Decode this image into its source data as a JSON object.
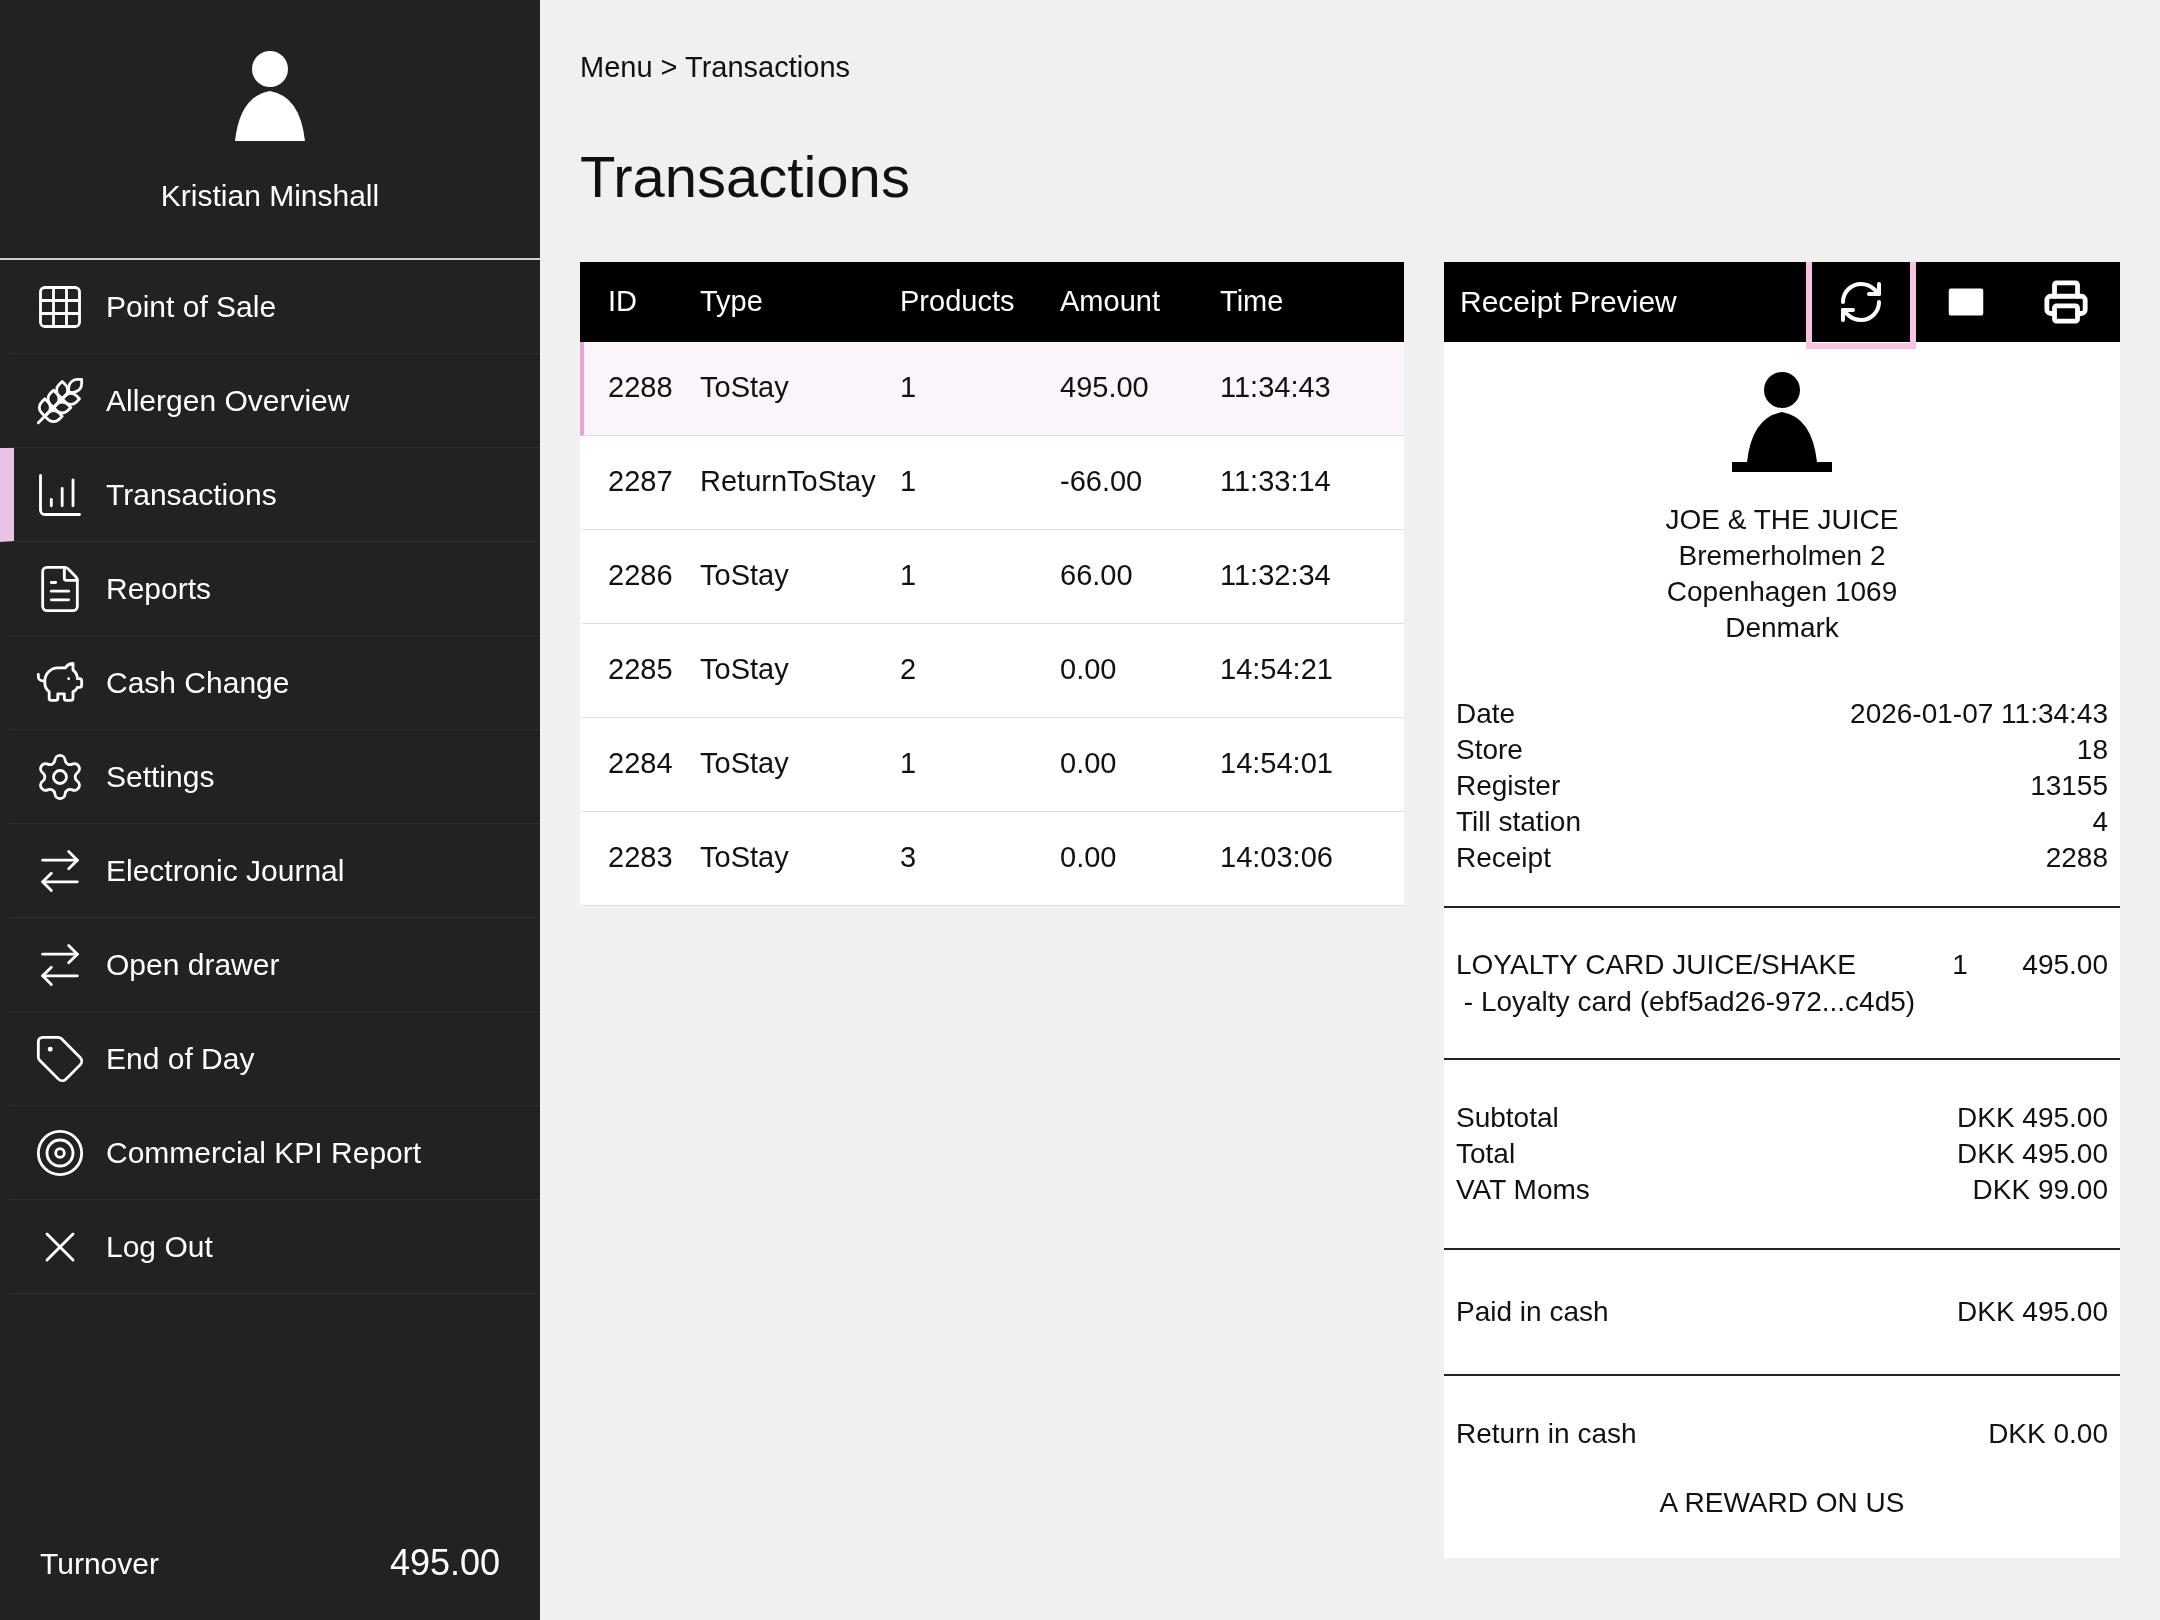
{
  "sidebar": {
    "user_name": "Kristian Minshall",
    "items": [
      {
        "label": "Point of Sale",
        "selected": false
      },
      {
        "label": "Allergen Overview",
        "selected": false
      },
      {
        "label": "Transactions",
        "selected": true
      },
      {
        "label": "Reports",
        "selected": false
      },
      {
        "label": "Cash Change",
        "selected": false
      },
      {
        "label": "Settings",
        "selected": false
      },
      {
        "label": "Electronic Journal",
        "selected": false
      },
      {
        "label": "Open drawer",
        "selected": false
      },
      {
        "label": "End of Day",
        "selected": false
      },
      {
        "label": "Commercial KPI Report",
        "selected": false
      },
      {
        "label": "Log Out",
        "selected": false
      }
    ],
    "turnover": {
      "label": "Turnover",
      "value": "495.00"
    }
  },
  "breadcrumb": "Menu > Transactions",
  "title": "Transactions",
  "table": {
    "columns": [
      "ID",
      "Type",
      "Products",
      "Amount",
      "Time"
    ],
    "rows": [
      {
        "cells": [
          "2288",
          "ToStay",
          "1",
          "495.00",
          "11:34:43"
        ],
        "selected": true
      },
      {
        "cells": [
          "2287",
          "ReturnToStay",
          "1",
          "-66.00",
          "11:33:14"
        ],
        "selected": false
      },
      {
        "cells": [
          "2286",
          "ToStay",
          "1",
          "66.00",
          "11:32:34"
        ],
        "selected": false
      },
      {
        "cells": [
          "2285",
          "ToStay",
          "2",
          "0.00",
          "14:54:21"
        ],
        "selected": false
      },
      {
        "cells": [
          "2284",
          "ToStay",
          "1",
          "0.00",
          "14:54:01"
        ],
        "selected": false
      },
      {
        "cells": [
          "2283",
          "ToStay",
          "3",
          "0.00",
          "14:03:06"
        ],
        "selected": false
      }
    ]
  },
  "receipt": {
    "title": "Receipt Preview",
    "refresh_focused": true,
    "address": [
      "JOE & THE JUICE",
      "Bremerholmen 2",
      "Copenhagen 1069",
      "Denmark"
    ],
    "info": [
      {
        "label": "Date",
        "value": "2026-01-07 11:34:43"
      },
      {
        "label": "Store",
        "value": "18"
      },
      {
        "label": "Register",
        "value": "13155"
      },
      {
        "label": "Till station",
        "value": "4"
      },
      {
        "label": "Receipt",
        "value": "2288"
      }
    ],
    "items": [
      {
        "name": "LOYALTY CARD JUICE/SHAKE",
        "qty": "1",
        "price": "495.00",
        "note": " - Loyalty card (ebf5ad26-972...c4d5)"
      }
    ],
    "totals": [
      {
        "label": "Subtotal",
        "value": "DKK 495.00"
      },
      {
        "label": "Total",
        "value": "DKK 495.00"
      },
      {
        "label": "VAT Moms",
        "value": "DKK 99.00"
      }
    ],
    "payment": {
      "label": "Paid in cash",
      "value": "DKK 495.00"
    },
    "return": {
      "label": "Return in cash",
      "value": "DKK 0.00"
    },
    "footer": "A REWARD ON US"
  }
}
